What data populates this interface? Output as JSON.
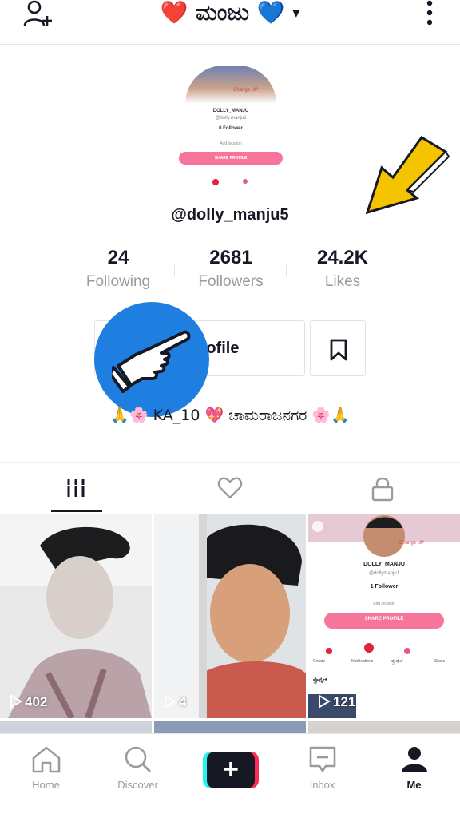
{
  "header": {
    "title": "❤️ ಮಂಜು 💙",
    "caret": "▾"
  },
  "preview_card": {
    "change_label": "Change UP",
    "name": "DOLLY_MANJU",
    "username": "@dolly.manju1",
    "followers": "0 Follower",
    "add_location": "Add location",
    "share_label": "SHARE PROFILE"
  },
  "profile": {
    "handle": "@dolly_manju5",
    "stats": [
      {
        "value": "24",
        "label": "Following"
      },
      {
        "value": "2681",
        "label": "Followers"
      },
      {
        "value": "24.2K",
        "label": "Likes"
      }
    ],
    "edit_label": "rofile",
    "bio": "🙏🌸 KA_10 💖 ಚಾಮರಾಜನಗರ 🌸🙏"
  },
  "videos": [
    {
      "views": "402"
    },
    {
      "views": "4"
    },
    {
      "views": "121"
    }
  ],
  "grid_card": {
    "change_label": "Change UP",
    "name": "DOLLY_MANJU",
    "username": "@dollymanju1",
    "followers": "1 Follower",
    "add_location": "Add location",
    "share_label": "SHARE PROFILE",
    "actions": [
      "Create",
      "Notifications",
      "ಪ್ರೊಫೈಲ್",
      "Share"
    ],
    "section_label": "ಪ್ರೊಫೈಲ್"
  },
  "nav": {
    "home": "Home",
    "discover": "Discover",
    "create": "+",
    "inbox": "Inbox",
    "me": "Me"
  },
  "colors": {
    "accent_pink": "#fe2c55",
    "accent_cyan": "#25f4ee",
    "share_pink": "#f7759b",
    "hand_blue": "#1f7fe0",
    "arrow_yellow": "#f5c400"
  }
}
